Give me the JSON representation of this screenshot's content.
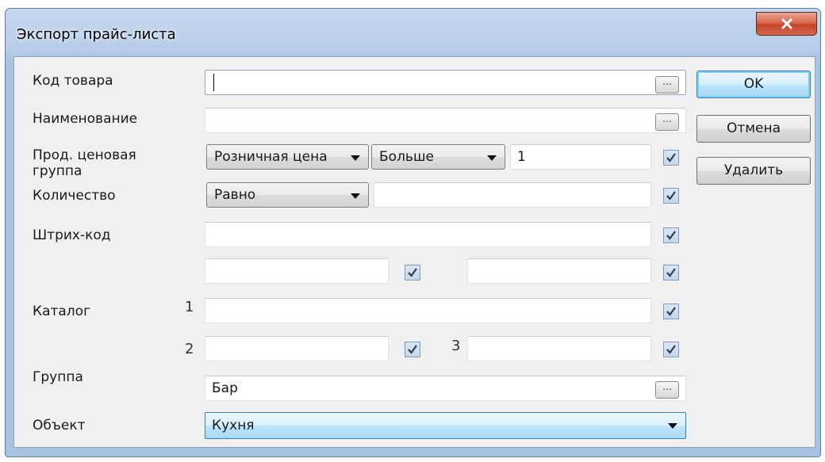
{
  "window": {
    "title": "Экспорт прайс-листа"
  },
  "labels": {
    "code": "Код товара",
    "name": "Наименование",
    "price_group": "Прод. ценовая группа",
    "quantity": "Количество",
    "barcode": "Штрих-код",
    "catalog": "Каталог",
    "group": "Группа",
    "object": "Объект"
  },
  "catalog_numbers": {
    "n1": "1",
    "n2": "2",
    "n3": "3"
  },
  "fields": {
    "code_value": "",
    "name_value": "",
    "price_value": "1",
    "quantity_value": "",
    "barcode_value": "",
    "extra_left_value": "",
    "extra_right_value": "",
    "catalog1_value": "",
    "catalog2_value": "",
    "catalog3_value": "",
    "group_value": "Бар"
  },
  "combos": {
    "price_type": "Розничная цена",
    "price_compare": "Больше",
    "quantity_compare": "Равно",
    "object": "Кухня"
  },
  "browse_label": "...",
  "checkboxes": {
    "price": true,
    "quantity": true,
    "barcode": true,
    "extra_left": true,
    "extra_right": true,
    "catalog1": true,
    "catalog2": true,
    "catalog3": true
  },
  "buttons": {
    "ok": "OK",
    "cancel": "Отмена",
    "delete": "Удалить"
  },
  "icons": {
    "close": "close-icon",
    "check": "checkmark-icon",
    "dropdown": "chevron-down-icon"
  }
}
